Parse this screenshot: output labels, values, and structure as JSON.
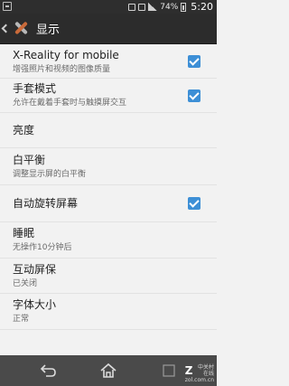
{
  "status_bar": {
    "battery_percent": "74%",
    "time": "5:20"
  },
  "action_bar": {
    "title": "显示"
  },
  "settings": {
    "items": [
      {
        "title": "X-Reality for mobile",
        "summary": "增强照片和视频的图像质量",
        "checked": true
      },
      {
        "title": "手套模式",
        "summary": "允许在戴着手套时与触摸屏交互",
        "checked": true
      },
      {
        "title": "亮度"
      },
      {
        "title": "白平衡",
        "summary": "调整显示屏的白平衡"
      },
      {
        "title": "自动旋转屏幕",
        "checked": true
      },
      {
        "title": "睡眠",
        "summary": "无操作10分钟后"
      },
      {
        "title": "互动屏保",
        "summary": "已关闭"
      },
      {
        "title": "字体大小",
        "summary": "正常"
      }
    ]
  },
  "watermark": {
    "brand": "Z",
    "line1": "中关村在线",
    "line2": "zol.com.cn"
  },
  "colors": {
    "checkbox_accent": "#3d8fd6",
    "action_bar": "#2c2c2c",
    "nav_bar": "#4a4a4a"
  }
}
